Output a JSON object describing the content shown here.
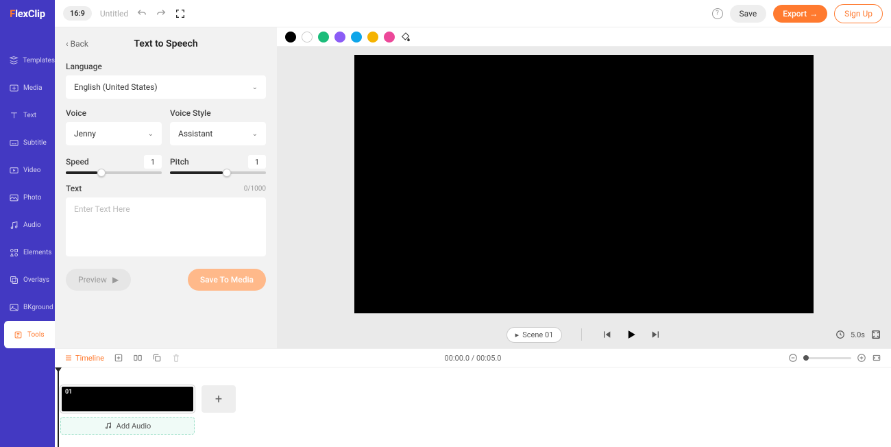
{
  "logo": {
    "accent": "F",
    "rest": "lexClip"
  },
  "sidebar": {
    "items": [
      {
        "label": "Templates"
      },
      {
        "label": "Media"
      },
      {
        "label": "Text"
      },
      {
        "label": "Subtitle"
      },
      {
        "label": "Video"
      },
      {
        "label": "Photo"
      },
      {
        "label": "Audio"
      },
      {
        "label": "Elements"
      },
      {
        "label": "Overlays"
      },
      {
        "label": "BKground"
      },
      {
        "label": "Tools"
      }
    ]
  },
  "topbar": {
    "ratio": "16:9",
    "title": "Untitled",
    "save": "Save",
    "export": "Export",
    "signup": "Sign Up"
  },
  "panel": {
    "back": "Back",
    "title": "Text to Speech",
    "language_label": "Language",
    "language_value": "English (United States)",
    "voice_label": "Voice",
    "voice_value": "Jenny",
    "style_label": "Voice Style",
    "style_value": "Assistant",
    "speed_label": "Speed",
    "speed_value": "1",
    "pitch_label": "Pitch",
    "pitch_value": "1",
    "text_label": "Text",
    "text_meta": "0/1000",
    "text_placeholder": "Enter Text Here",
    "preview": "Preview",
    "save_media": "Save To Media"
  },
  "colors": [
    "#000000",
    "#ffffff",
    "#1bbc7a",
    "#8b5cf6",
    "#0ea5e9",
    "#f5b301",
    "#ec4899"
  ],
  "player": {
    "scene_label": "Scene 01",
    "duration": "5.0s"
  },
  "timeline": {
    "label": "Timeline",
    "time": "00:00.0 / 00:05.0",
    "scene_num": "01",
    "add_audio": "Add Audio"
  }
}
